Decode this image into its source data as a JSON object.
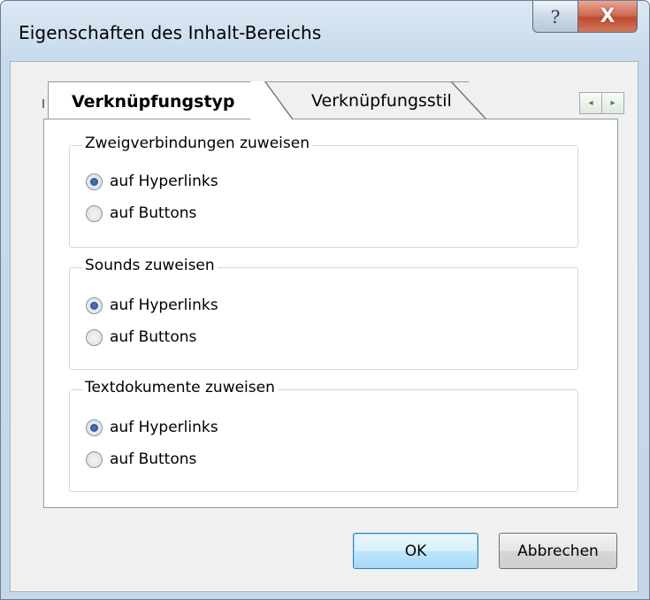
{
  "window": {
    "title": "Eigenschaften des Inhalt-Bereichs",
    "help_glyph": "?",
    "close_glyph": "X"
  },
  "tabs": [
    {
      "label": "Verknüpfungstyp",
      "active": true
    },
    {
      "label": "Verknüpfungsstil",
      "active": false
    }
  ],
  "tab_scroll": {
    "left": "◂",
    "right": "▸"
  },
  "groups": [
    {
      "label": "Zweigverbindungen zuweisen",
      "options": [
        {
          "label": "auf Hyperlinks",
          "checked": true
        },
        {
          "label": "auf Buttons",
          "checked": false
        }
      ]
    },
    {
      "label": "Sounds zuweisen",
      "options": [
        {
          "label": "auf Hyperlinks",
          "checked": true
        },
        {
          "label": "auf Buttons",
          "checked": false
        }
      ]
    },
    {
      "label": "Textdokumente zuweisen",
      "options": [
        {
          "label": "auf Hyperlinks",
          "checked": true
        },
        {
          "label": "auf Buttons",
          "checked": false
        }
      ]
    }
  ],
  "buttons": {
    "ok": "OK",
    "cancel": "Abbrechen"
  }
}
